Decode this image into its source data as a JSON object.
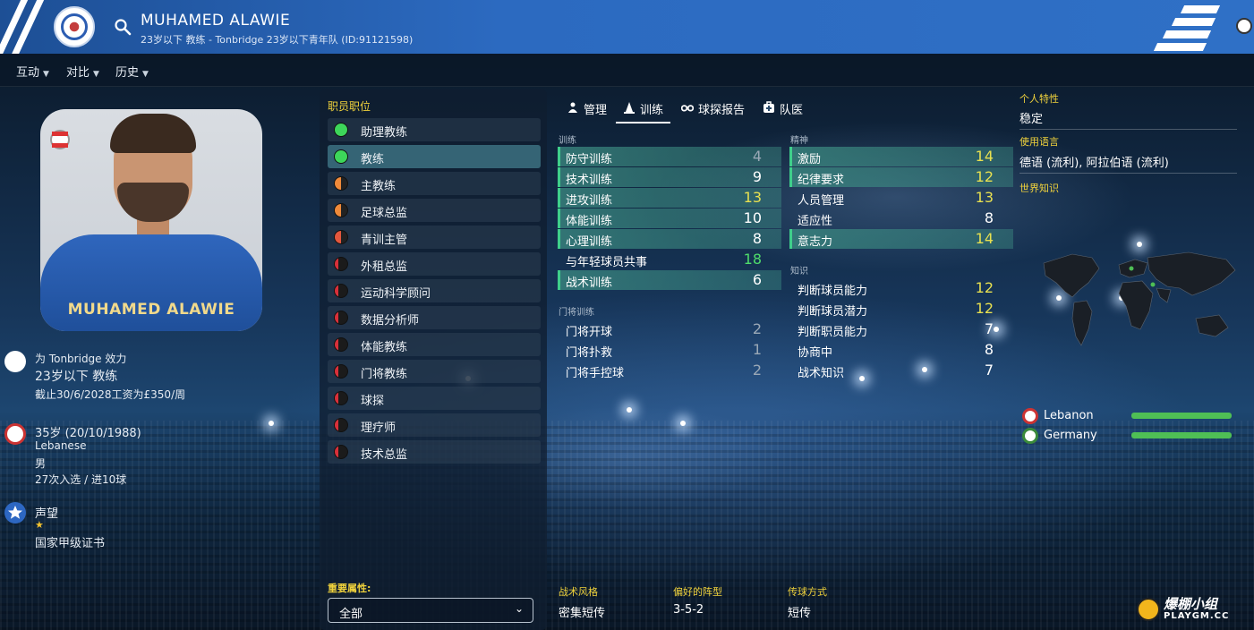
{
  "header": {
    "name": "MUHAMED ALAWIE",
    "subtitle": "23岁以下 教练 - Tonbridge 23岁以下青年队 (ID:91121598)"
  },
  "submenu": [
    {
      "label": "互动"
    },
    {
      "label": "对比"
    },
    {
      "label": "历史"
    }
  ],
  "profile": {
    "shirt_text": "MUHAMED ALAWIE",
    "club_line": "为 Tonbridge 效力",
    "role_line": "23岁以下 教练",
    "contract_line": "截止30/6/2028工资为£350/周",
    "age_line": "35岁 (20/10/1988)",
    "nationality": "Lebanese",
    "gender": "男",
    "caps_line": "27次入选 / 进10球",
    "reputation_label": "声望",
    "reputation_stars": "★",
    "license": "国家甲级证书"
  },
  "roles": {
    "title": "职员职位",
    "items": [
      {
        "label": "助理教练",
        "color": "#3dd65a",
        "state": "full"
      },
      {
        "label": "教练",
        "color": "#3dd65a",
        "state": "full"
      },
      {
        "label": "主教练",
        "color": "#f08a3a",
        "state": "half"
      },
      {
        "label": "足球总监",
        "color": "#f08a3a",
        "state": "half"
      },
      {
        "label": "青训主管",
        "color": "#e4573d",
        "state": "half"
      },
      {
        "label": "外租总监",
        "color": "#d8303a",
        "state": "low"
      },
      {
        "label": "运动科学顾问",
        "color": "#d8303a",
        "state": "low"
      },
      {
        "label": "数据分析师",
        "color": "#d8303a",
        "state": "low"
      },
      {
        "label": "体能教练",
        "color": "#d8303a",
        "state": "low"
      },
      {
        "label": "门将教练",
        "color": "#d8303a",
        "state": "low"
      },
      {
        "label": "球探",
        "color": "#d8303a",
        "state": "low"
      },
      {
        "label": "理疗师",
        "color": "#d8303a",
        "state": "low"
      },
      {
        "label": "技术总监",
        "color": "#d8303a",
        "state": "low"
      }
    ],
    "selected_index": 1,
    "key_attr_label": "重要属性:",
    "key_attr_value": "全部"
  },
  "tabs": [
    {
      "label": "管理",
      "icon": "person-icon"
    },
    {
      "label": "训练",
      "icon": "cone-icon"
    },
    {
      "label": "球探报告",
      "icon": "binoculars-icon"
    },
    {
      "label": "队医",
      "icon": "medkit-icon"
    }
  ],
  "active_tab": 1,
  "training": {
    "label": "训练",
    "items": [
      {
        "name": "防守训练",
        "value": 4,
        "tone": "grey",
        "hl": true
      },
      {
        "name": "技术训练",
        "value": 9,
        "tone": "white",
        "hl": true
      },
      {
        "name": "进攻训练",
        "value": 13,
        "tone": "yellow",
        "hl": true
      },
      {
        "name": "体能训练",
        "value": 10,
        "tone": "white",
        "hl": true
      },
      {
        "name": "心理训练",
        "value": 8,
        "tone": "white",
        "hl": true
      },
      {
        "name": "与年轻球员共事",
        "value": 18,
        "tone": "green",
        "hl": false
      },
      {
        "name": "战术训练",
        "value": 6,
        "tone": "white",
        "hl": true
      }
    ]
  },
  "goalkeeping": {
    "label": "门将训练",
    "items": [
      {
        "name": "门将开球",
        "value": 2,
        "tone": "grey",
        "hl": false
      },
      {
        "name": "门将扑救",
        "value": 1,
        "tone": "grey",
        "hl": false
      },
      {
        "name": "门将手控球",
        "value": 2,
        "tone": "grey",
        "hl": false
      }
    ]
  },
  "mental": {
    "label": "精神",
    "items": [
      {
        "name": "激励",
        "value": 14,
        "tone": "yellow",
        "hl": true
      },
      {
        "name": "纪律要求",
        "value": 12,
        "tone": "yellow",
        "hl": true
      },
      {
        "name": "人员管理",
        "value": 13,
        "tone": "yellow",
        "hl": false
      },
      {
        "name": "适应性",
        "value": 8,
        "tone": "white",
        "hl": false
      },
      {
        "name": "意志力",
        "value": 14,
        "tone": "yellow",
        "hl": true
      }
    ]
  },
  "knowledge": {
    "label": "知识",
    "items": [
      {
        "name": "判断球员能力",
        "value": 12,
        "tone": "yellow",
        "hl": false
      },
      {
        "name": "判断球员潜力",
        "value": 12,
        "tone": "yellow",
        "hl": false
      },
      {
        "name": "判断职员能力",
        "value": 7,
        "tone": "white",
        "hl": false
      },
      {
        "name": "协商中",
        "value": 8,
        "tone": "white",
        "hl": false
      },
      {
        "name": "战术知识",
        "value": 7,
        "tone": "white",
        "hl": false
      }
    ]
  },
  "bottom": {
    "style_label": "战术风格",
    "style_value": "密集短传",
    "formation_label": "偏好的阵型",
    "formation_value": "3-5-2",
    "passing_label": "传球方式",
    "passing_value": "短传"
  },
  "right": {
    "traits_label": "个人特性",
    "traits_value": "稳定",
    "language_label": "使用语言",
    "language_value": "德语 (流利), 阿拉伯语 (流利)",
    "world_label": "世界知识",
    "nations": [
      {
        "name": "Lebanon",
        "level": 1.0
      },
      {
        "name": "Germany",
        "level": 1.0
      }
    ]
  },
  "watermark": {
    "line1": "爆棚小组",
    "line2": "PLAYGM.CC"
  }
}
